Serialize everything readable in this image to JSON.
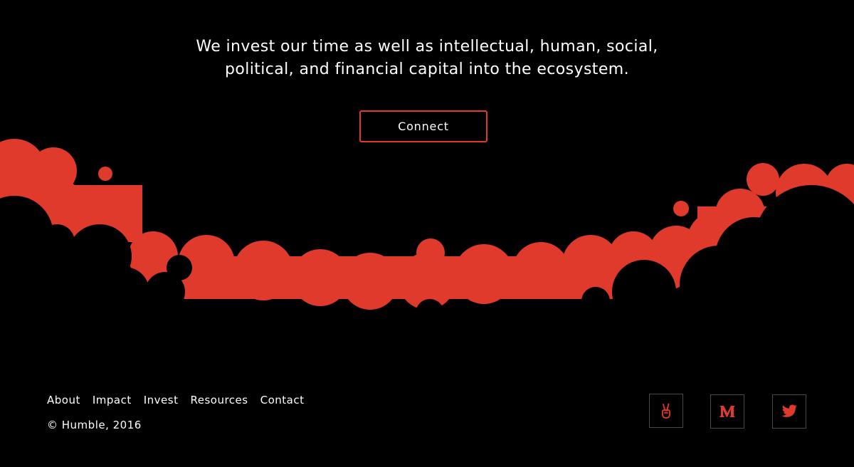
{
  "hero": {
    "tagline_line1": "We invest our time as well as intellectual, human, social,",
    "tagline_line2": "political, and financial capital into the ecosystem.",
    "connect_label": "Connect"
  },
  "footer": {
    "nav": [
      "About",
      "Impact",
      "Invest",
      "Resources",
      "Contact"
    ],
    "copyright": "© Humble, 2016",
    "social_icons": [
      "angellist-icon",
      "medium-icon",
      "twitter-icon"
    ]
  },
  "colors": {
    "background": "#000000",
    "accent": "#e03a2c",
    "text": "#ffffff",
    "icon_border": "#4a4a4a"
  }
}
